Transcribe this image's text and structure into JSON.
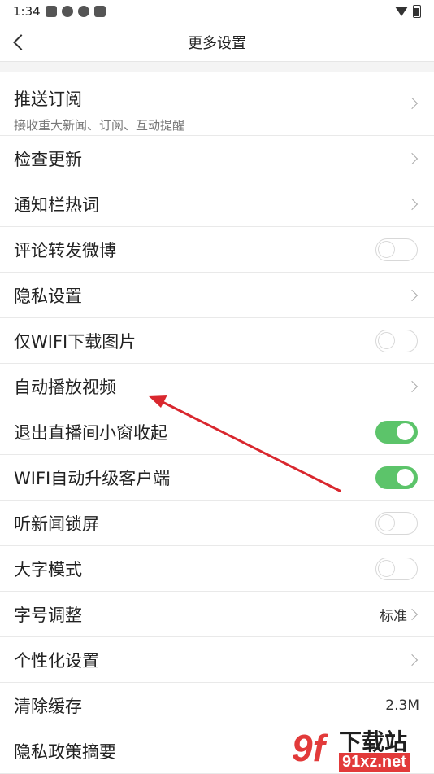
{
  "status_bar": {
    "time": "1:34",
    "notification_icons": [
      "app-icon",
      "pinwheel-icon",
      "pinwheel-icon",
      "a-icon"
    ],
    "right_icons": [
      "wifi-icon",
      "battery-icon"
    ]
  },
  "header": {
    "title": "更多设置"
  },
  "settings": {
    "push": {
      "label": "推送订阅",
      "sub": "接收重大新闻、订阅、互动提醒"
    },
    "update": {
      "label": "检查更新"
    },
    "hotwords": {
      "label": "通知栏热词"
    },
    "weibo": {
      "label": "评论转发微博",
      "toggle": false
    },
    "privacy": {
      "label": "隐私设置"
    },
    "wifi_images": {
      "label": "仅WIFI下载图片",
      "toggle": false
    },
    "autoplay": {
      "label": "自动播放视频"
    },
    "live_window": {
      "label": "退出直播间小窗收起",
      "toggle": true
    },
    "wifi_upgrade": {
      "label": "WIFI自动升级客户端",
      "toggle": true
    },
    "lock_screen": {
      "label": "听新闻锁屏",
      "toggle": false
    },
    "large_text": {
      "label": "大字模式",
      "toggle": false
    },
    "font_size": {
      "label": "字号调整",
      "value": "标准"
    },
    "personalize": {
      "label": "个性化设置"
    },
    "cache": {
      "label": "清除缓存",
      "value": "2.3M"
    },
    "policy": {
      "label": "隐私政策摘要"
    }
  },
  "colors": {
    "toggle_on": "#5cc46a",
    "annotation_arrow": "#d9272e"
  },
  "watermark": {
    "logo": "9f",
    "text": "下载站",
    "url": "91xz.net"
  }
}
